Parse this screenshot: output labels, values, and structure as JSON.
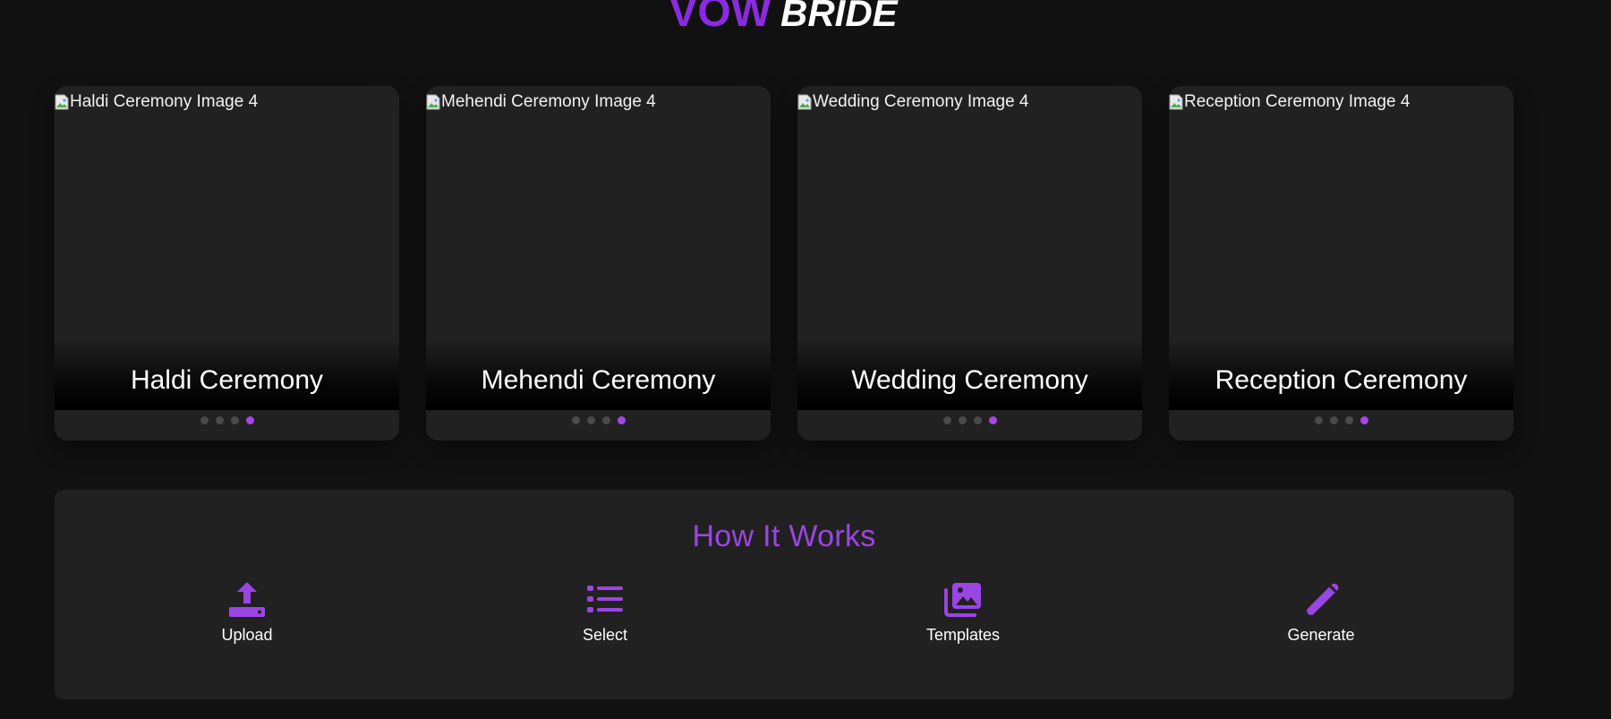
{
  "logo": {
    "part1": "VOW",
    "part2": "BRIDE"
  },
  "colors": {
    "background": "#111111",
    "card": "#212121",
    "accent": "#9b45e4",
    "brand": "#8a2be2",
    "dot_inactive": "#4a4a4a",
    "dot_active": "#a347e6"
  },
  "cards": [
    {
      "alt": "Haldi Ceremony Image 4",
      "title": "Haldi Ceremony",
      "slides": 4,
      "active_slide": 4
    },
    {
      "alt": "Mehendi Ceremony Image 4",
      "title": "Mehendi Ceremony",
      "slides": 4,
      "active_slide": 4
    },
    {
      "alt": "Wedding Ceremony Image 4",
      "title": "Wedding Ceremony",
      "slides": 4,
      "active_slide": 4
    },
    {
      "alt": "Reception Ceremony Image 4",
      "title": "Reception Ceremony",
      "slides": 4,
      "active_slide": 4
    }
  ],
  "how_it_works": {
    "title": "How It Works",
    "steps": [
      {
        "label": "Upload",
        "icon": "upload-icon"
      },
      {
        "label": "Select",
        "icon": "list-icon"
      },
      {
        "label": "Templates",
        "icon": "images-icon"
      },
      {
        "label": "Generate",
        "icon": "magic-wand-icon"
      }
    ]
  }
}
